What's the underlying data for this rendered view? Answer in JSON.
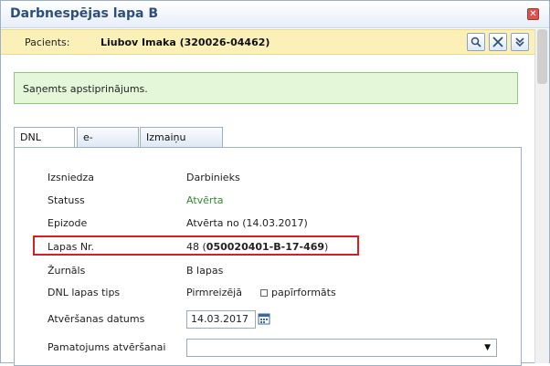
{
  "window": {
    "title": "Darbnespējas lapa B",
    "close_label": "✕"
  },
  "patient": {
    "label": "Pacients:",
    "value": "Liubov Imaka (320026-04462)"
  },
  "toolbar": {
    "search": "🔍",
    "tools": "⚒",
    "expand": "»"
  },
  "alert": {
    "text": "Saņemts apstiprinājums."
  },
  "tabs": [
    {
      "label": "DNL saturs"
    },
    {
      "label": "e-Veselība"
    },
    {
      "label": "Izmaiņu vēsture"
    }
  ],
  "fields": {
    "izsniedza": {
      "label": "Izsniedza",
      "value": "Darbinieks"
    },
    "statuss": {
      "label": "Statuss",
      "value": "Atvērta"
    },
    "epizode": {
      "label": "Epizode",
      "value": "Atvērta no (14.03.2017)"
    },
    "lapas_nr": {
      "label": "Lapas Nr.",
      "value_prefix": "48 (",
      "value_bold": "050020401-B-17-469",
      "value_suffix": ")"
    },
    "zurnals": {
      "label": "Žurnāls",
      "value": "B lapas"
    },
    "dnl_tips": {
      "label": "DNL lapas tips",
      "value": "Pirmreizējā",
      "checkbox_label": "papīrformāts"
    },
    "atversanas_datums": {
      "label": "Atvēršanas datums",
      "value": "14.03.2017"
    },
    "pamatojums": {
      "label": "Pamatojums atvēršanai",
      "value": ""
    }
  },
  "colors": {
    "status_green": "#2e8b2e",
    "highlight_red": "#d42020",
    "patient_bar": "#fbf1b8",
    "alert_bg": "#e4f7d9"
  }
}
